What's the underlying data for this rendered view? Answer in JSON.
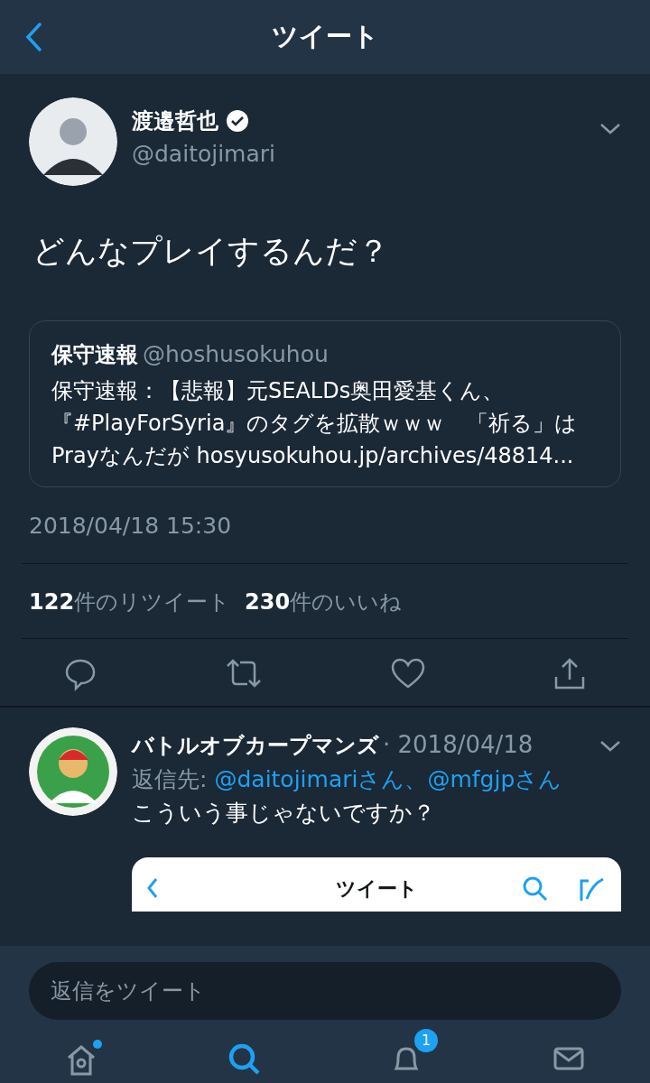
{
  "header": {
    "title": "ツイート"
  },
  "tweet": {
    "name": "渡邉哲也",
    "verified": true,
    "handle": "@daitojimari",
    "text": "どんなプレイするんだ？",
    "quote": {
      "name": "保守速報",
      "handle": "@hoshusokuhou",
      "text": "保守速報：【悲報】元SEALDs奥田愛基くん、『#PlayForSyria』のタグを拡散ｗｗｗ　「祈る」はPrayなんだが hosyusokuhou.jp/archives/48814..."
    },
    "timestamp": "2018/04/18 15:30",
    "stats": [
      "**122**件のリツイート",
      "**230**件のいいね"
    ]
  },
  "reply": {
    "name": "バトルオブカープマンズ",
    "date": "· 2018/04/18",
    "reply_to_label": "返信先:",
    "mentions": [
      "@daitojimariさん、",
      "@mfgjpさん"
    ],
    "text": "こういう事じゃないですか？",
    "attachment": {
      "title": "ツイート"
    }
  },
  "reply_field": {
    "placeholder": "返信をツイート"
  },
  "tab_bar": [
    {
      "kind": "home",
      "selected": false,
      "new": true
    },
    {
      "kind": "search",
      "selected": true,
      "new": false
    },
    {
      "kind": "notifications",
      "selected": false,
      "new": false,
      "badge": "1"
    },
    {
      "kind": "messages",
      "selected": false,
      "new": false
    }
  ]
}
